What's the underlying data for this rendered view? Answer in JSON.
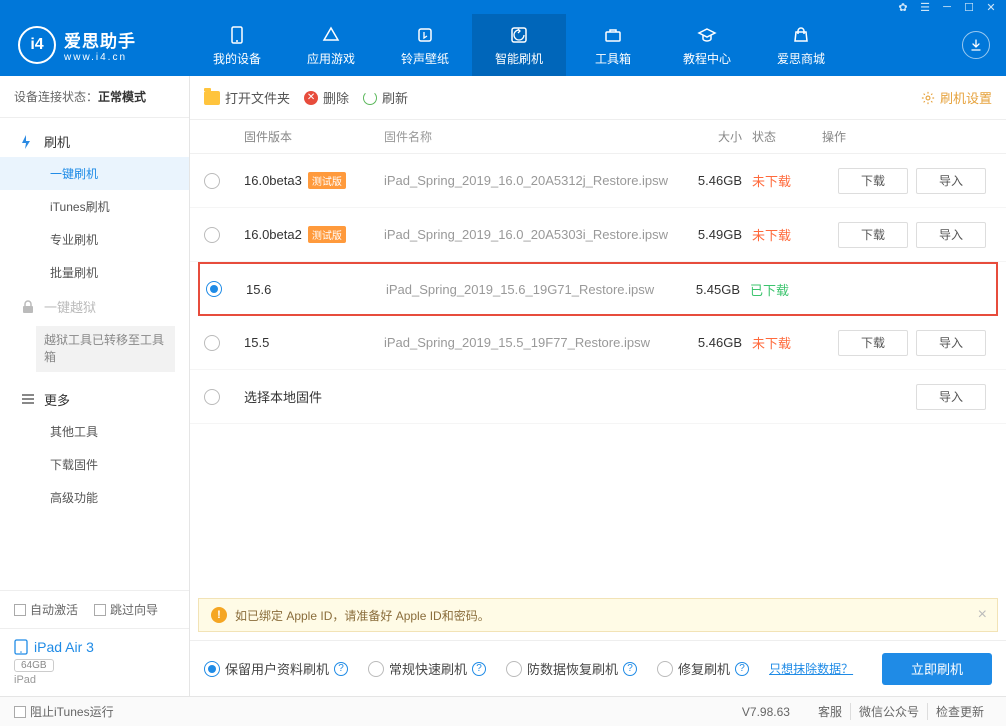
{
  "titlebar_icons": [
    "settings",
    "list",
    "minimize",
    "maximize",
    "close"
  ],
  "logo": {
    "cn": "爱思助手",
    "en": "www.i4.cn"
  },
  "nav": [
    {
      "label": "我的设备",
      "id": "device"
    },
    {
      "label": "应用游戏",
      "id": "apps"
    },
    {
      "label": "铃声壁纸",
      "id": "ringtones"
    },
    {
      "label": "智能刷机",
      "id": "flash",
      "active": true
    },
    {
      "label": "工具箱",
      "id": "tools"
    },
    {
      "label": "教程中心",
      "id": "tutorial"
    },
    {
      "label": "爱思商城",
      "id": "store"
    }
  ],
  "conn_status": {
    "prefix": "设备连接状态：",
    "mode": "正常模式"
  },
  "sidebar": {
    "groups": [
      {
        "icon": "flash",
        "label": "刷机",
        "children": [
          "一键刷机",
          "iTunes刷机",
          "专业刷机",
          "批量刷机"
        ],
        "active_child": 0
      },
      {
        "icon": "lock",
        "label": "一键越狱",
        "muted": true,
        "note": "越狱工具已转移至工具箱"
      },
      {
        "icon": "more",
        "label": "更多",
        "children": [
          "其他工具",
          "下载固件",
          "高级功能"
        ]
      }
    ],
    "auto_activate": "自动激活",
    "skip_guide": "跳过向导",
    "device": {
      "name": "iPad Air 3",
      "capacity": "64GB",
      "type": "iPad"
    }
  },
  "toolbar": {
    "open": "打开文件夹",
    "delete": "删除",
    "refresh": "刷新",
    "settings": "刷机设置"
  },
  "table": {
    "headers": {
      "version": "固件版本",
      "name": "固件名称",
      "size": "大小",
      "status": "状态",
      "ops": "操作"
    },
    "rows": [
      {
        "version": "16.0beta3",
        "beta": "测试版",
        "name": "iPad_Spring_2019_16.0_20A5312j_Restore.ipsw",
        "size": "5.46GB",
        "status": "未下载",
        "status_class": "un",
        "download": true,
        "import": true
      },
      {
        "version": "16.0beta2",
        "beta": "测试版",
        "name": "iPad_Spring_2019_16.0_20A5303i_Restore.ipsw",
        "size": "5.49GB",
        "status": "未下载",
        "status_class": "un",
        "download": true,
        "import": true
      },
      {
        "version": "15.6",
        "name": "iPad_Spring_2019_15.6_19G71_Restore.ipsw",
        "size": "5.45GB",
        "status": "已下载",
        "status_class": "done",
        "selected": true
      },
      {
        "version": "15.5",
        "name": "iPad_Spring_2019_15.5_19F77_Restore.ipsw",
        "size": "5.46GB",
        "status": "未下载",
        "status_class": "un",
        "download": true,
        "import": true
      },
      {
        "version": "选择本地固件",
        "local": true,
        "import": true
      }
    ],
    "btn_download": "下载",
    "btn_import": "导入"
  },
  "warn": "如已绑定 Apple ID，请准备好 Apple ID和密码。",
  "flash_opts": {
    "opts": [
      "保留用户资料刷机",
      "常规快速刷机",
      "防数据恢复刷机",
      "修复刷机"
    ],
    "selected": 0,
    "erase_link": "只想抹除数据？",
    "flash_btn": "立即刷机"
  },
  "footer": {
    "block_itunes": "阻止iTunes运行",
    "version": "V7.98.63",
    "links": [
      "客服",
      "微信公众号",
      "检查更新"
    ]
  }
}
